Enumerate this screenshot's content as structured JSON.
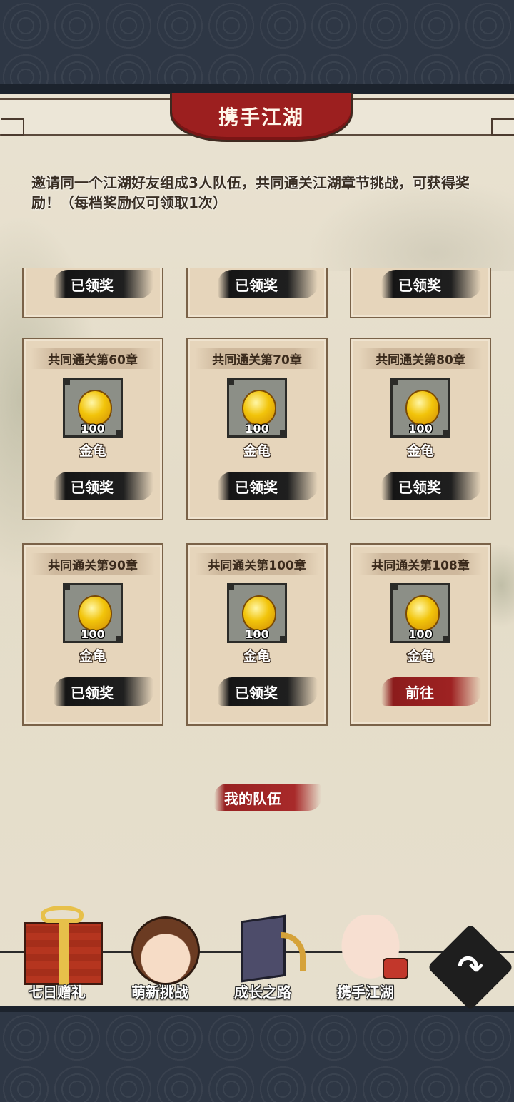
{
  "header": {
    "title": "携手江湖"
  },
  "description": "邀请同一个江湖好友组成3人队伍，共同通关江湖章节挑战，可获得奖励！（每档奖励仅可领取1次）",
  "partial_row": [
    {
      "status": "已领奖"
    },
    {
      "status": "已领奖"
    },
    {
      "status": "已领奖"
    }
  ],
  "rewards": [
    {
      "title": "共同通关第60章",
      "item": "金龟",
      "qty": "100",
      "status": "已领奖"
    },
    {
      "title": "共同通关第70章",
      "item": "金龟",
      "qty": "100",
      "status": "已领奖"
    },
    {
      "title": "共同通关第80章",
      "item": "金龟",
      "qty": "100",
      "status": "已领奖"
    },
    {
      "title": "共同通关第90章",
      "item": "金龟",
      "qty": "100",
      "status": "已领奖"
    },
    {
      "title": "共同通关第100章",
      "item": "金龟",
      "qty": "100",
      "status": "已领奖"
    },
    {
      "title": "共同通关第108章",
      "item": "金龟",
      "qty": "100",
      "status": "前往"
    }
  ],
  "team_button": "我的队伍",
  "nav": [
    {
      "label": "七日赠礼",
      "icon": "gift-box-icon"
    },
    {
      "label": "萌新挑战",
      "icon": "girl-avatar-icon"
    },
    {
      "label": "成长之路",
      "icon": "book-arrow-icon"
    },
    {
      "label": "携手江湖",
      "icon": "handshake-icon"
    }
  ],
  "share_icon": "share-arrow-icon",
  "colors": {
    "accent_red": "#9c1f1f",
    "parchment": "#e6dfcd",
    "card": "#e6d5bb",
    "band": "#2e3745"
  }
}
